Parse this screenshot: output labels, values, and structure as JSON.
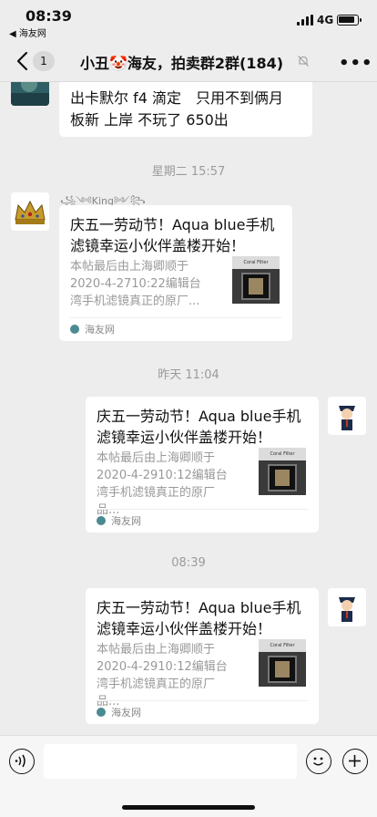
{
  "status_bar": {
    "time": "08:39",
    "back_app": "◀ 海友网",
    "network": "4G",
    "battery_level": 0.9
  },
  "nav": {
    "unread_count": "1",
    "title": "小丑🤡海友，拍卖群2群(184)",
    "more": "•••"
  },
  "messages": {
    "m1": {
      "text_line1": "出卡默尔 f4 滴定　只用不到俩月",
      "text_line2": "板新  上岸 不玩了  650出"
    },
    "sep1": "星期二 15:57",
    "m2": {
      "sender": "꧁༺King༻꧂",
      "title": "庆五一劳动节！Aqua blue手机滤镜幸运小伙伴盖楼开始！",
      "desc": "本帖最后由上海卿顺于2020-4-2710:22编辑台湾手机滤镜真正的原厂...",
      "thumb_label": "Coral Filter",
      "source": "海友网"
    },
    "sep2": "昨天 11:04",
    "m3": {
      "title": "庆五一劳动节！Aqua blue手机滤镜幸运小伙伴盖楼开始！",
      "desc": "本帖最后由上海卿顺于2020-4-2910:12编辑台湾手机滤镜真正的原厂品...",
      "thumb_label": "Coral Filter",
      "source": "海友网"
    },
    "sep3": "08:39",
    "m4": {
      "title": "庆五一劳动节！Aqua blue手机滤镜幸运小伙伴盖楼开始！",
      "desc": "本帖最后由上海卿顺于2020-4-2910:12编辑台湾手机滤镜真正的原厂品...",
      "thumb_label": "Coral Filter",
      "source": "海友网"
    }
  },
  "colors": {
    "background": "#ededed",
    "bubble": "#ffffff",
    "link_source": "#4a8a91"
  }
}
